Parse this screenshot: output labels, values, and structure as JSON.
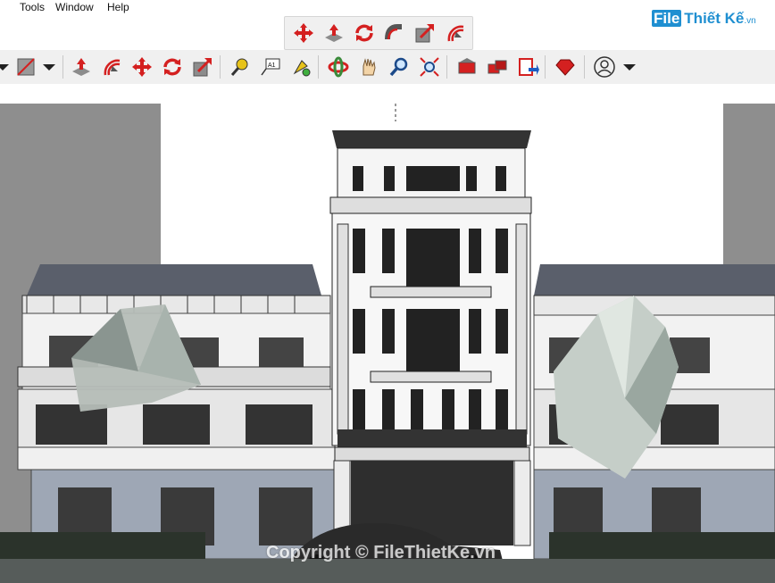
{
  "menubar": {
    "items": [
      {
        "label": "Tools"
      },
      {
        "label": "Window"
      },
      {
        "label": "Help"
      }
    ]
  },
  "logo": {
    "text": "File",
    "text2": "Thiết Kế",
    "suffix": ".vn"
  },
  "toolbar_top": {
    "icons": [
      "move-icon",
      "push-pull-icon",
      "rotate-icon",
      "follow-me-icon",
      "scale-icon",
      "offset-icon"
    ]
  },
  "toolbar_main": {
    "icons": [
      "paint-bucket-icon",
      "push-pull-icon",
      "offset-icon",
      "move-icon",
      "rotate-icon",
      "scale-icon",
      "tape-measure-icon",
      "text-icon",
      "paint-icon",
      "orbit-icon",
      "pan-icon",
      "zoom-icon",
      "zoom-extents-icon",
      "warehouse-icon",
      "extension-warehouse-icon",
      "layout-icon",
      "ruby-console-icon",
      "account-icon"
    ],
    "text_tool_label": "A1"
  },
  "watermark": {
    "text": "Copyright © FileThietKe.vn"
  },
  "colors": {
    "toolbar_bg": "#f0f0f0",
    "viewport_bg": "#ffffff",
    "accent_red": "#d42020",
    "logo_blue": "#1f8fd1"
  }
}
